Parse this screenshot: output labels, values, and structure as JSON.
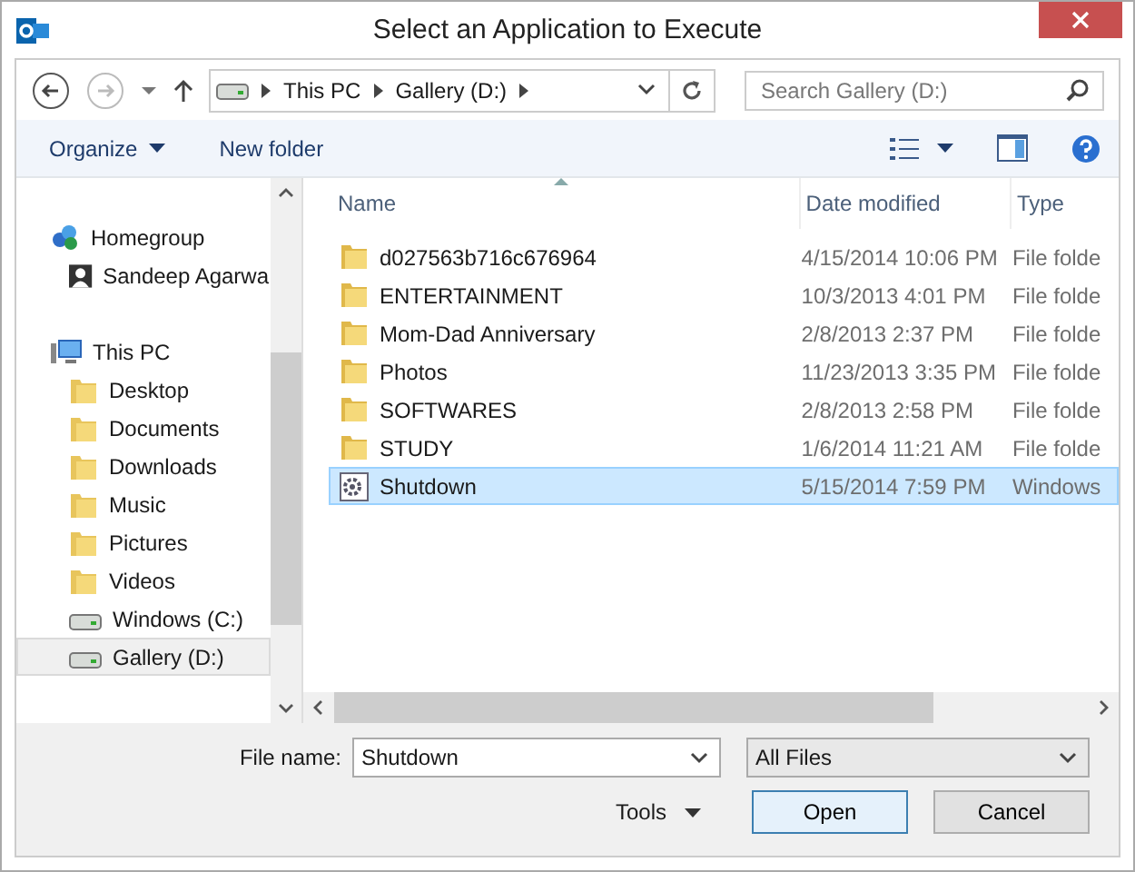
{
  "window": {
    "title": "Select an Application to Execute"
  },
  "address": {
    "crumbs": [
      "This PC",
      "Gallery (D:)"
    ]
  },
  "search": {
    "placeholder": "Search Gallery (D:)"
  },
  "toolbar": {
    "organize": "Organize",
    "new_folder": "New folder"
  },
  "sidebar": {
    "items": [
      {
        "label": "Homegroup",
        "kind": "homegroup",
        "selected": false,
        "children": [
          {
            "label": "Sandeep Agarwa",
            "kind": "user",
            "selected": false
          }
        ]
      },
      {
        "label": "This PC",
        "kind": "pc",
        "selected": false,
        "children": [
          {
            "label": "Desktop",
            "kind": "folder",
            "selected": false
          },
          {
            "label": "Documents",
            "kind": "folder",
            "selected": false
          },
          {
            "label": "Downloads",
            "kind": "folder",
            "selected": false
          },
          {
            "label": "Music",
            "kind": "folder",
            "selected": false
          },
          {
            "label": "Pictures",
            "kind": "folder",
            "selected": false
          },
          {
            "label": "Videos",
            "kind": "folder",
            "selected": false
          },
          {
            "label": "Windows (C:)",
            "kind": "drive",
            "selected": false
          },
          {
            "label": "Gallery (D:)",
            "kind": "drive",
            "selected": true
          }
        ]
      }
    ]
  },
  "table": {
    "columns": [
      "Name",
      "Date modified",
      "Type"
    ],
    "rows": [
      {
        "name": "d027563b716c676964",
        "date": "4/15/2014 10:06 PM",
        "type": "File folde",
        "kind": "folder",
        "selected": false
      },
      {
        "name": "ENTERTAINMENT",
        "date": "10/3/2013 4:01 PM",
        "type": "File folde",
        "kind": "folder",
        "selected": false
      },
      {
        "name": "Mom-Dad Anniversary",
        "date": "2/8/2013 2:37 PM",
        "type": "File folde",
        "kind": "folder",
        "selected": false
      },
      {
        "name": "Photos",
        "date": "11/23/2013 3:35 PM",
        "type": "File folde",
        "kind": "folder",
        "selected": false
      },
      {
        "name": "SOFTWARES",
        "date": "2/8/2013 2:58 PM",
        "type": "File folde",
        "kind": "folder",
        "selected": false
      },
      {
        "name": "STUDY",
        "date": "1/6/2014 11:21 AM",
        "type": "File folde",
        "kind": "folder",
        "selected": false
      },
      {
        "name": "Shutdown",
        "date": "5/15/2014 7:59 PM",
        "type": "Windows",
        "kind": "shortcut",
        "selected": true
      }
    ]
  },
  "footer": {
    "file_name_label": "File name:",
    "file_name": "Shutdown",
    "filter": "All Files",
    "tools": "Tools",
    "buttons": [
      "Open",
      "Cancel"
    ]
  }
}
